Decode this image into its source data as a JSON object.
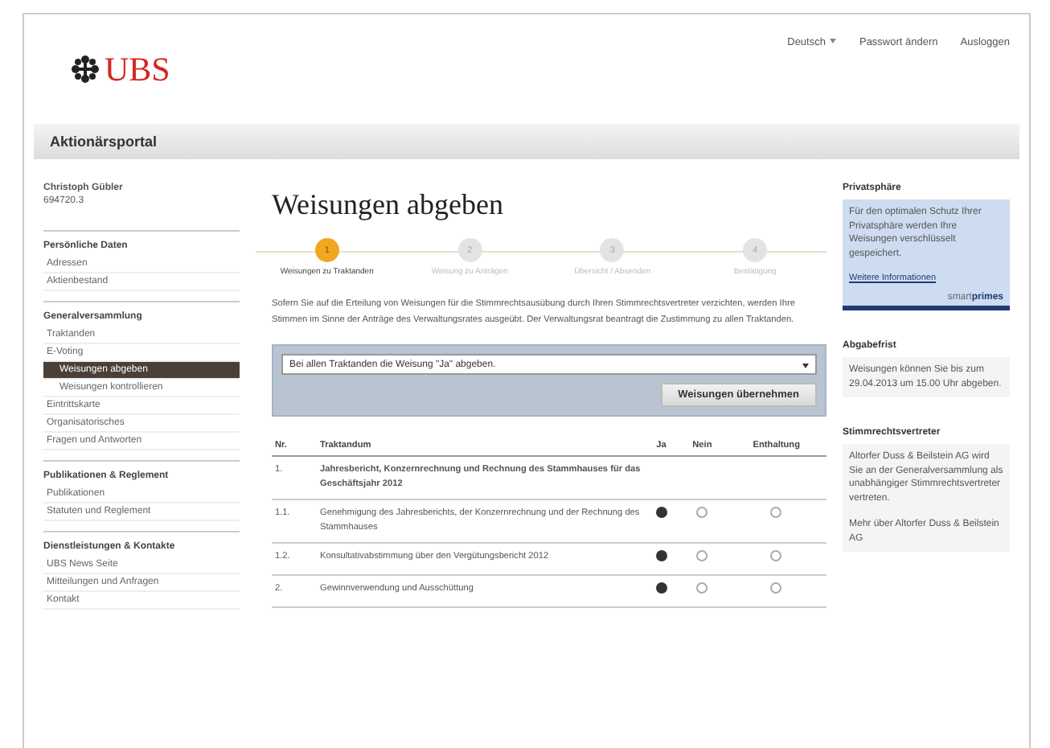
{
  "header": {
    "logo": "UBS",
    "links": [
      {
        "label": "Deutsch",
        "kind": "dropdown"
      },
      {
        "label": "Passwort ändern",
        "kind": "link"
      },
      {
        "label": "Ausloggen",
        "kind": "link"
      }
    ]
  },
  "portal_title": "Aktionärsportal",
  "user": {
    "name": "Christoph Gübler",
    "number": "694720.3"
  },
  "sidebar": [
    {
      "title": "Persönliche Daten",
      "items": [
        {
          "label": "Adressen",
          "selected": false
        },
        {
          "label": "Aktienbestand",
          "selected": false
        }
      ]
    },
    {
      "title": "Generalversammlung",
      "items": [
        {
          "label": "Traktanden",
          "selected": false
        },
        {
          "label": "E-Voting",
          "selected": false,
          "children": [
            {
              "label": "Weisungen abgeben",
              "selected": true
            },
            {
              "label": "Weisungen kontrollieren",
              "selected": false
            }
          ]
        },
        {
          "label": "Eintrittskarte",
          "selected": false
        },
        {
          "label": "Organisatorisches",
          "selected": false
        },
        {
          "label": "Fragen und Antworten",
          "selected": false
        }
      ]
    },
    {
      "title": "Publikationen & Reglement",
      "items": [
        {
          "label": "Publikationen",
          "selected": false
        },
        {
          "label": "Statuten und Reglement",
          "selected": false
        }
      ]
    },
    {
      "title": "Dienstleistungen & Kontakte",
      "items": [
        {
          "label": "UBS News Seite",
          "selected": false
        },
        {
          "label": "Mitteilungen und Anfragen",
          "selected": false
        },
        {
          "label": "Kontakt",
          "selected": false
        }
      ]
    }
  ],
  "page_title": "Weisungen abgeben",
  "steps": [
    {
      "number": "1",
      "label": "Weisungen zu Traktanden",
      "selected": true
    },
    {
      "number": "2",
      "label": "Weisung zu Anträgen",
      "selected": false
    },
    {
      "number": "3",
      "label": "Übersicht / Absenden",
      "selected": false
    },
    {
      "number": "4",
      "label": "Bestätigung",
      "selected": false
    }
  ],
  "intro": "Sofern Sie auf die Erteilung von Weisungen für die Stimmrechtsausübung durch Ihren Stimmrechtsvertreter verzichten, werden Ihre Stimmen im Sinne der Anträge des Verwaltungsrates ausgeübt. Der Verwaltungsrat beantragt die Zustimmung zu allen Traktanden.",
  "bulk": {
    "select": "Bei allen Traktanden die Weisung \"Ja\" abgeben.",
    "button": "Weisungen übernehmen"
  },
  "table": {
    "columns": [
      "Nr.",
      "Traktandum",
      "Ja",
      "Nein",
      "Enthaltung"
    ],
    "rows": [
      {
        "kind": "group",
        "number": "1.",
        "title": "Jahresbericht, Konzernrechnung und Rechnung des Stammhauses für das Geschäftsjahr 2012"
      },
      {
        "kind": "item",
        "number": "1.1.",
        "title": "Genehmigung des Jahresberichts, der Konzernrechnung und der Rechnung des Stammhauses",
        "options": [
          {
            "checked": true
          },
          {
            "checked": false
          },
          {
            "checked": false
          }
        ]
      },
      {
        "kind": "item",
        "number": "1.2.",
        "title": "Konsultativabstimmung über den Vergütungsbericht 2012",
        "options": [
          {
            "checked": true
          },
          {
            "checked": false
          },
          {
            "checked": false
          }
        ]
      },
      {
        "kind": "item",
        "number": "2.",
        "title": "Gewinnverwendung und Ausschüttung",
        "options": [
          {
            "checked": true
          },
          {
            "checked": false
          },
          {
            "checked": false
          }
        ]
      }
    ]
  },
  "right": {
    "privacy": {
      "title": "Privatsphäre",
      "text": "Für den optimalen Schutz Ihrer Privatsphäre werden Ihre Weisungen verschlüsselt gespeichert.",
      "link": "Weitere Informationen",
      "brand_light": "smart",
      "brand_bold": "primes"
    },
    "deadline": {
      "title": "Abgabefrist",
      "text": "Weisungen können Sie bis zum 29.04.2013 um 15.00 Uhr abgeben."
    },
    "proxy": {
      "title": "Stimmrechtsvertreter",
      "text": "Altorfer Duss & Beilstein AG wird Sie an der Generalversammlung als unabhängiger Stimmrechtsvertreter vertreten.",
      "link": "Mehr über Altorfer Duss & Beilstein AG"
    }
  }
}
